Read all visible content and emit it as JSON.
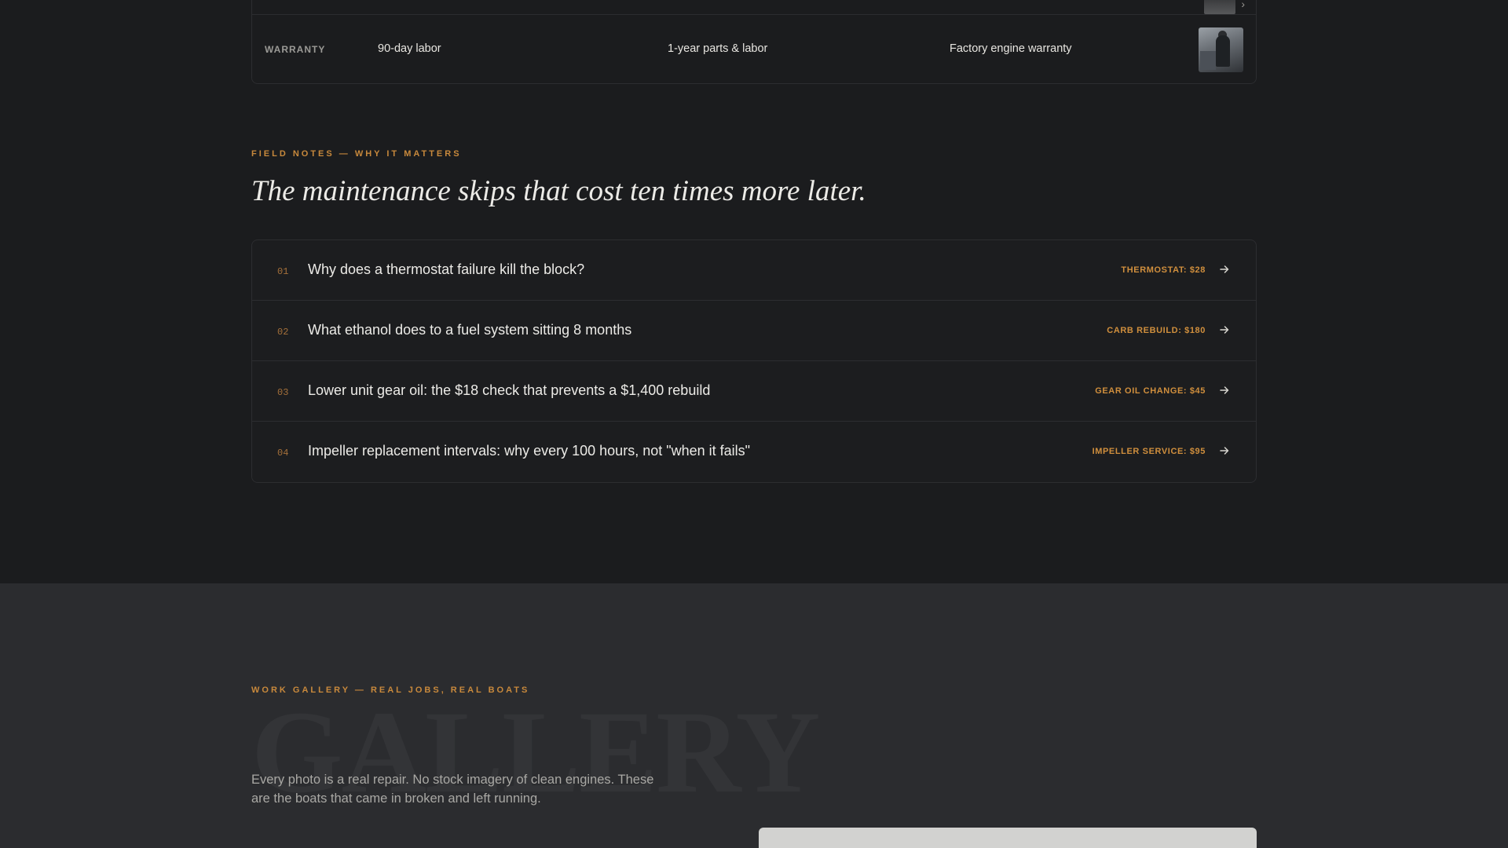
{
  "compare_table": {
    "warranty_row": {
      "label": "WARRANTY",
      "cells": [
        "90-day labor",
        "1-year parts & labor",
        "Factory engine warranty"
      ],
      "thumbnail_icon": "mechanic-photo"
    }
  },
  "field_notes": {
    "eyebrow": "FIELD NOTES — WHY IT MATTERS",
    "heading": "The maintenance skips that cost ten times more later.",
    "items": [
      {
        "num": "01",
        "title": "Why does a thermostat failure kill the block?",
        "price": "THERMOSTAT: $28",
        "icon": "arrow-right-icon"
      },
      {
        "num": "02",
        "title": "What ethanol does to a fuel system sitting 8 months",
        "price": "CARB REBUILD: $180",
        "icon": "arrow-right-icon"
      },
      {
        "num": "03",
        "title": "Lower unit gear oil: the $18 check that prevents a $1,400 rebuild",
        "price": "GEAR OIL CHANGE: $45",
        "icon": "arrow-right-icon"
      },
      {
        "num": "04",
        "title": "Impeller replacement intervals: why every 100 hours, not \"when it fails\"",
        "price": "IMPELLER SERVICE: $95",
        "icon": "arrow-right-icon"
      }
    ]
  },
  "gallery": {
    "eyebrow": "WORK GALLERY — REAL JOBS, REAL BOATS",
    "watermark": "GALLERY",
    "description": "Every photo is a real repair. No stock imagery of clean engines. These are the boats that came in broken and left running."
  },
  "colors": {
    "background": "#1b1c1e",
    "gallery_background": "#2b2c2f",
    "accent": "#c8893c",
    "text": "#ecebe7",
    "muted": "#a9a8a4",
    "border": "#2c2d30"
  }
}
